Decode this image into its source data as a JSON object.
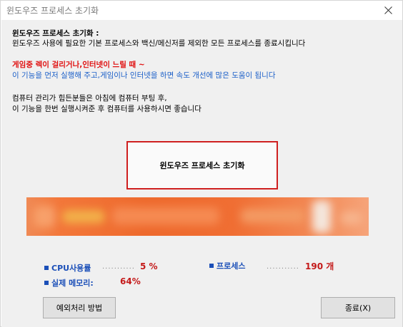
{
  "window": {
    "title": "윈도우즈 프로세스 초기화"
  },
  "description": {
    "heading": "윈도우즈 프로세스 초기화 :",
    "line1": "윈도우즈 사용에 필요한 기본 프로세스와 백신/메신저를 제외한 모든 프로세스를 종료시킵니다",
    "warning": "게임중 렉이 걸리거나,인터넷이 느릴 때 ~",
    "tip": "이 기능을 먼저 실행해 주고,게임이나 인터넷을 하면 속도 개선에 많은 도움이 됩니다",
    "note1": "컴퓨터 관리가 힘든분들은 아침에 컴퓨터 부팅 후,",
    "note2": "이 기능을 한번 실행시켜준 후 컴퓨터를 사용하시면 좋습니다"
  },
  "main_button": {
    "label": "윈도우즈 프로세스 초기화"
  },
  "stats": {
    "cpu_label": "CPU사용률",
    "cpu_value": "5 %",
    "memory_label": "실제 메모리:",
    "memory_value": "64%",
    "process_label": "프로세스",
    "process_value": "190 개",
    "dots": "..........."
  },
  "buttons": {
    "exception_label": "예외처리 방법",
    "exit_label": "종료(X)"
  },
  "colors": {
    "accent_red": "#cf1f1f",
    "label_blue": "#1b4fb8",
    "value_red": "#c41a1a",
    "banner_orange": "#ee6a2d"
  }
}
